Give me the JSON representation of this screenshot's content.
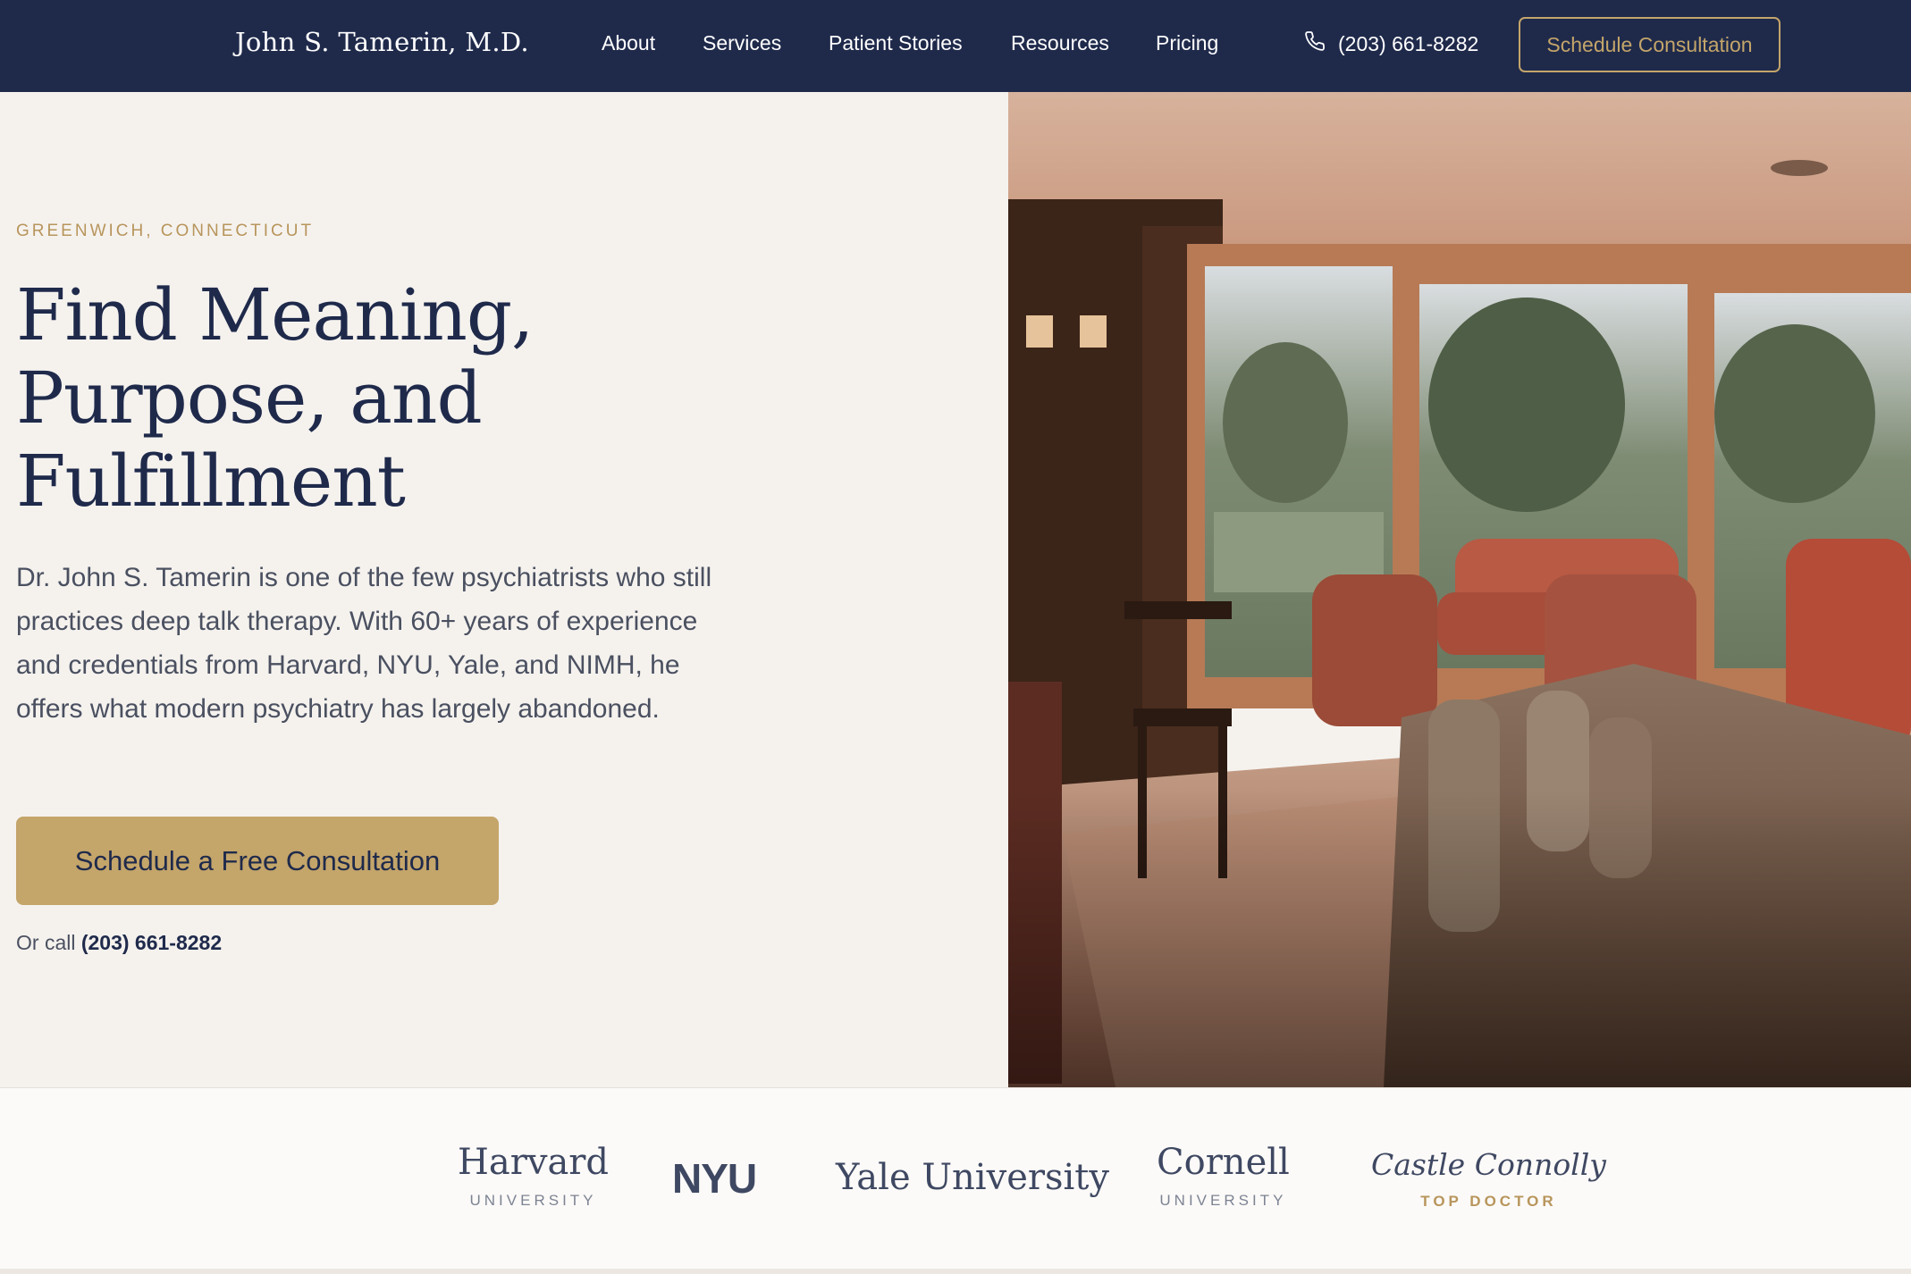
{
  "nav": {
    "brand": "John S. Tamerin, M.D.",
    "links": [
      "About",
      "Services",
      "Patient Stories",
      "Resources",
      "Pricing"
    ],
    "phone": "(203) 661-8282",
    "phone_icon": "phone-icon",
    "cta_label": "Schedule Consultation"
  },
  "hero": {
    "eyebrow": "GREENWICH, CONNECTICUT",
    "headline": [
      "Find Meaning,",
      "Purpose, and",
      "Fulfillment"
    ],
    "lede": "Dr. John S. Tamerin is one of the few psychiatrists who still practices deep talk therapy. With 60+ years of experience and credentials from Harvard, NYU, Yale, and NIMH, he offers what modern psychiatry has largely abandoned.",
    "cta_label": "Schedule a Free Consultation",
    "or_call_prefix": "Or call",
    "or_call_phone": "(203) 661-8282"
  },
  "credentials": {
    "harvard": {
      "name": "Harvard",
      "sub": "UNIVERSITY"
    },
    "nyu": {
      "name": "NYU"
    },
    "yale": {
      "name": "Yale University"
    },
    "cornell": {
      "name": "Cornell",
      "sub": "UNIVERSITY"
    },
    "castle": {
      "name": "Castle Connolly",
      "sub": "TOP DOCTOR"
    }
  },
  "colors": {
    "navy": "#1f2a4b",
    "gold": "#c4a56a",
    "cream": "#f5f2ee"
  }
}
